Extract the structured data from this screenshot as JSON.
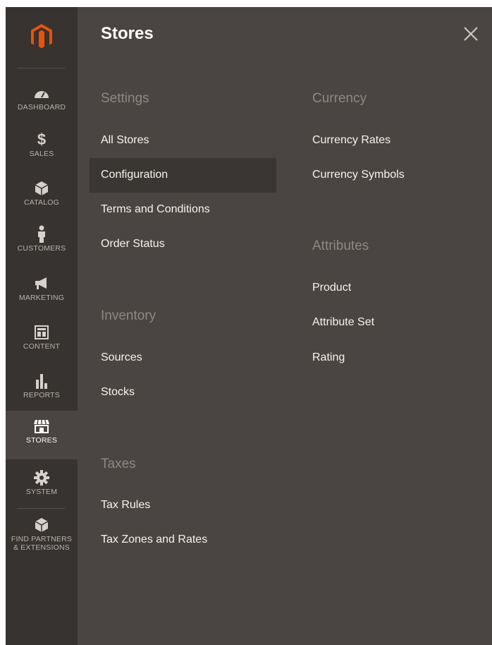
{
  "sidebar": {
    "items": [
      {
        "label": "DASHBOARD",
        "icon": "dashboard-icon"
      },
      {
        "label": "SALES",
        "icon": "dollar-icon"
      },
      {
        "label": "CATALOG",
        "icon": "catalog-box-icon"
      },
      {
        "label": "CUSTOMERS",
        "icon": "customer-person-icon"
      },
      {
        "label": "MARKETING",
        "icon": "megaphone-icon"
      },
      {
        "label": "CONTENT",
        "icon": "content-layout-icon"
      },
      {
        "label": "REPORTS",
        "icon": "bar-chart-icon"
      },
      {
        "label": "STORES",
        "icon": "storefront-icon",
        "active": true
      },
      {
        "label": "SYSTEM",
        "icon": "gear-icon"
      },
      {
        "label_line1": "FIND PARTNERS",
        "label_line2": "& EXTENSIONS",
        "icon": "partners-box-icon"
      }
    ]
  },
  "panel": {
    "title": "Stores",
    "close_icon": "close-icon",
    "sections": {
      "settings": {
        "title": "Settings",
        "links": [
          "All Stores",
          "Configuration",
          "Terms and Conditions",
          "Order Status"
        ]
      },
      "inventory": {
        "title": "Inventory",
        "links": [
          "Sources",
          "Stocks"
        ]
      },
      "taxes": {
        "title": "Taxes",
        "links": [
          "Tax Rules",
          "Tax Zones and Rates"
        ]
      },
      "currency": {
        "title": "Currency",
        "links": [
          "Currency Rates",
          "Currency Symbols"
        ]
      },
      "attributes": {
        "title": "Attributes",
        "links": [
          "Product",
          "Attribute Set",
          "Rating"
        ]
      }
    }
  },
  "colors": {
    "brand_orange": "#eb5202",
    "sidebar_bg": "#373330",
    "panel_bg": "#4a4542",
    "section_title": "#8e8883",
    "link_text": "#f7f3eb"
  }
}
